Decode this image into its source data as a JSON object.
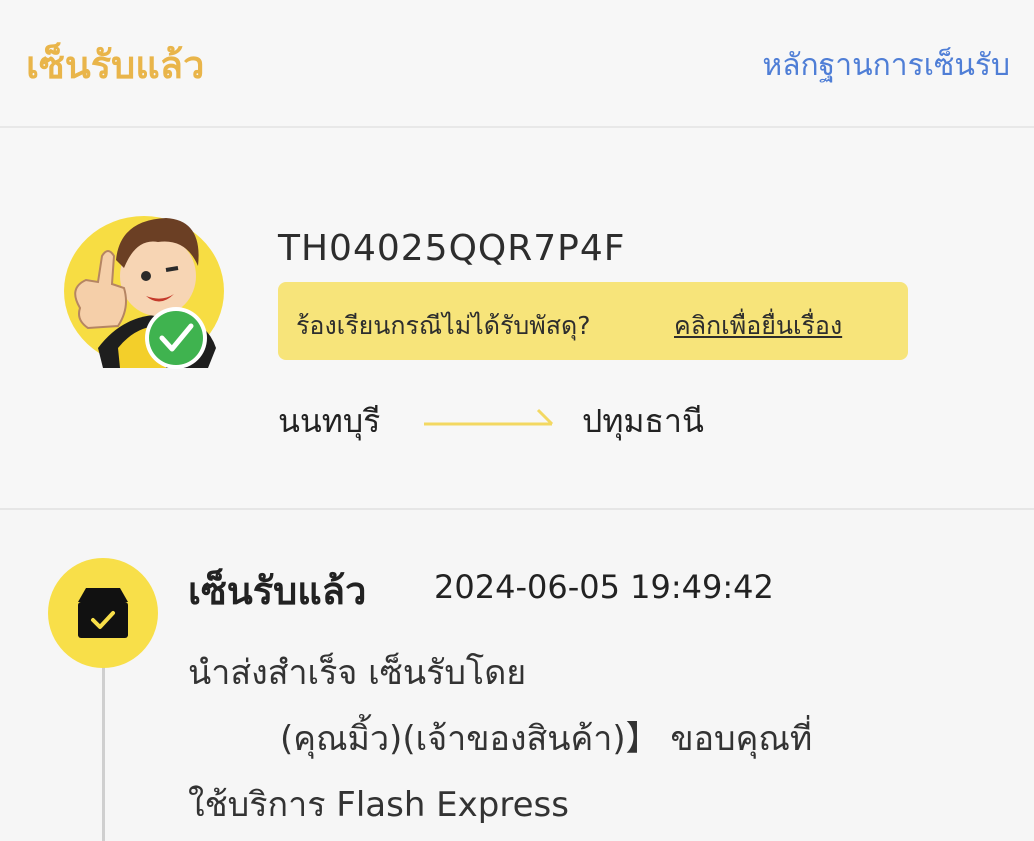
{
  "header": {
    "status_title": "เซ็นรับแล้ว",
    "proof_link": "หลักฐานการเซ็นรับ"
  },
  "parcel": {
    "tracking_number": "TH04025QQR7P4F",
    "complaint_prompt": "ร้องเรียนกรณีไม่ได้รับพัสดุ?",
    "complaint_link": "คลิกเพื่อยื่นเรื่อง",
    "origin": "นนทบุรี",
    "destination": "ปทุมธานี"
  },
  "timeline": {
    "event_title": "เซ็นรับแล้ว",
    "event_time": "2024-06-05 19:49:42",
    "line1": "นำส่งสำเร็จ เซ็นรับโดย",
    "line2": "(คุณมิ้ว)(เจ้าของสินค้า)】 ขอบคุณที่",
    "line3": "ใช้บริการ Flash Express"
  },
  "colors": {
    "accent_yellow": "#f8df49",
    "status_orange": "#e9b54a",
    "link_blue": "#4f7ed6",
    "success_green": "#3fb34f"
  },
  "icons": [
    "mascot-avatar",
    "check-icon",
    "arrow-right-icon",
    "box-check-icon"
  ]
}
